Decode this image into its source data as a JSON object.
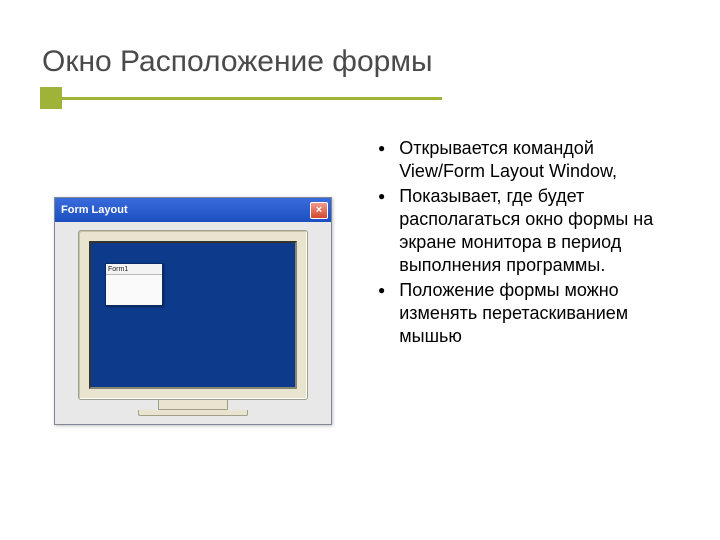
{
  "title": "Окно Расположение формы",
  "bullets": [
    "Открывается командой View/Form Layout Window,",
    "Показывает, где будет располагаться окно формы на экране монитора в период выполнения программы.",
    " Положение формы можно изменять перетаскиванием мышью"
  ],
  "window": {
    "title": "Form Layout",
    "close_glyph": "×",
    "form_label": "Form1"
  }
}
